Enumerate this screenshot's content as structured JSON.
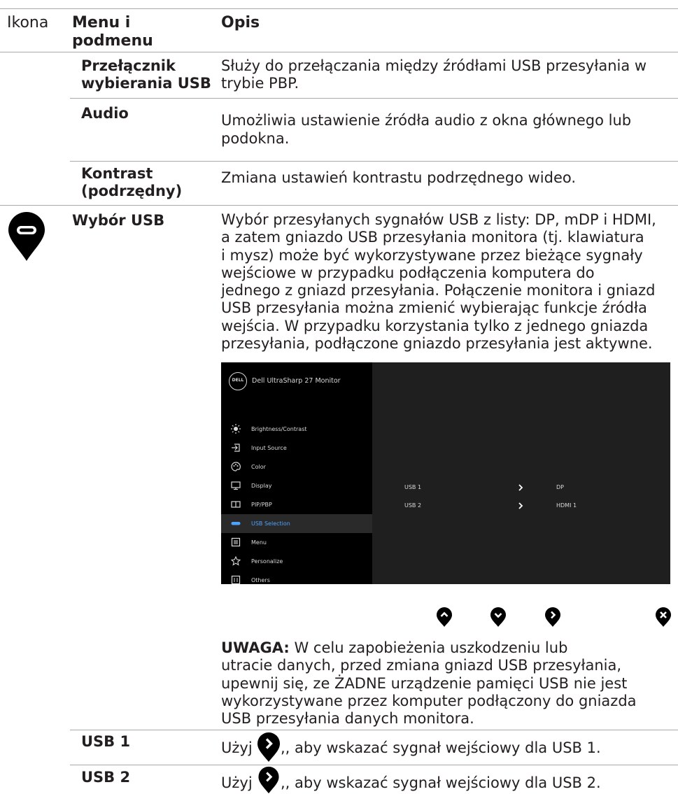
{
  "header": {
    "col_icon": "Ikona",
    "col_menu_line1": "Menu i",
    "col_menu_line2": "podmenu",
    "col_desc": "Opis"
  },
  "rows": {
    "usb_switch": {
      "name_line1": "Przełącznik",
      "name_line2": "wybierania USB",
      "desc_line1": "Służy do przełączania między źródłami USB przesyłania w",
      "desc_line2": "trybie PBP."
    },
    "audio": {
      "name": "Audio",
      "desc_line1": "Umożliwia ustawienie źródła audio z okna głównego lub",
      "desc_line2": "podokna."
    },
    "contrast": {
      "name_line1": "Kontrast",
      "name_line2": "(podrzędny)",
      "desc": "Zmiana ustawień kontrastu podrzędnego wideo."
    },
    "usb_selection": {
      "name": "Wybór USB",
      "desc_lines": [
        "Wybór przesyłanych sygnałów USB z listy: DP, mDP i HDMI,",
        "a zatem gniazdo USB przesyłania monitora (tj. klawiatura",
        "i mysz) może być wykorzystywane przez bieżące sygnały",
        "wejściowe w przypadku podłączenia komputera do",
        "jednego z gniazd przesyłania. Połączenie monitora i gniazd",
        "USB przesyłania można zmienić wybierając funkcje źródła",
        "wejścia. W przypadku korzystania tylko z jednego gniazda",
        "przesyłania, podłączone gniazdo przesyłania jest aktywne."
      ],
      "note_label": "UWAGA:",
      "note_line1": " W celu zapobieżenia uszkodzeniu lub",
      "note_lines": [
        "utracie danych, przed zmiana gniazd USB przesyłania,",
        "upewnij się, ze ŻADNE urządzenie pamięci USB nie jest",
        "wykorzystywane przez komputer podłączony do gniazda",
        "USB przesyłania danych monitora."
      ]
    },
    "usb1": {
      "name": "USB 1",
      "desc_prefix": "Użyj",
      "desc_suffix": ",, aby wskazać sygnał wejściowy dla USB 1."
    },
    "usb2": {
      "name": "USB 2",
      "desc_prefix": "Użyj",
      "desc_suffix": ",, aby wskazać sygnał wejściowy dla USB 2."
    }
  },
  "osd": {
    "brand": "DELL",
    "title": "Dell UltraSharp 27 Monitor",
    "menu": [
      {
        "label": "Brightness/Contrast",
        "icon": "sun-icon"
      },
      {
        "label": "Input Source",
        "icon": "input-icon"
      },
      {
        "label": "Color",
        "icon": "palette-icon"
      },
      {
        "label": "Display",
        "icon": "monitor-icon"
      },
      {
        "label": "PIP/PBP",
        "icon": "pip-icon"
      },
      {
        "label": "USB Selection",
        "icon": "usb-icon",
        "selected": true
      },
      {
        "label": "Menu",
        "icon": "menu-icon"
      },
      {
        "label": "Personalize",
        "icon": "star-icon"
      },
      {
        "label": "Others",
        "icon": "others-icon"
      }
    ],
    "options": [
      {
        "label": "USB 1",
        "value": "DP"
      },
      {
        "label": "USB 2",
        "value": "HDMI 1"
      }
    ],
    "accent": "#4da3ff"
  },
  "nav_buttons": [
    "up-icon",
    "down-icon",
    "right-icon",
    "close-icon"
  ]
}
